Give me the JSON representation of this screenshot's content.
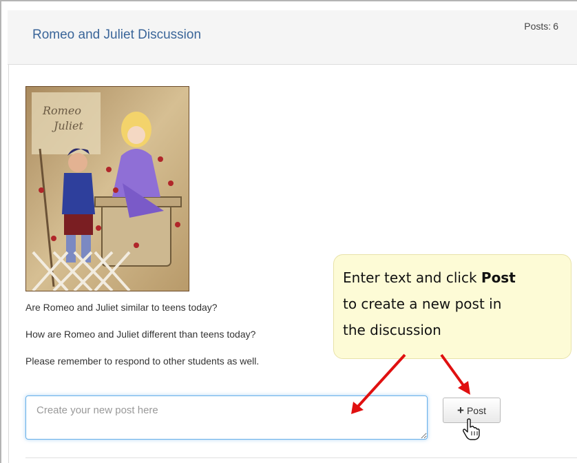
{
  "header": {
    "title": "Romeo and Juliet Discussion",
    "posts_label": "Posts:",
    "posts_count": "6"
  },
  "prompts": [
    "Are Romeo and Juliet similar to teens today?",
    "How are Romeo and Juliet different than teens today?",
    "Please remember to respond to other students as well."
  ],
  "composer": {
    "placeholder": "Create your new post here",
    "value": "",
    "post_icon": "plus-icon",
    "post_label": "Post"
  },
  "callout": {
    "line1_pre": "Enter text and click ",
    "line1_bold": "Post",
    "line2": "to create a new post in",
    "line3": "the discussion"
  },
  "colors": {
    "title": "#3a6599",
    "callout_bg": "#fdfbd6",
    "arrow": "#e01010",
    "input_focus": "#66afe9"
  }
}
